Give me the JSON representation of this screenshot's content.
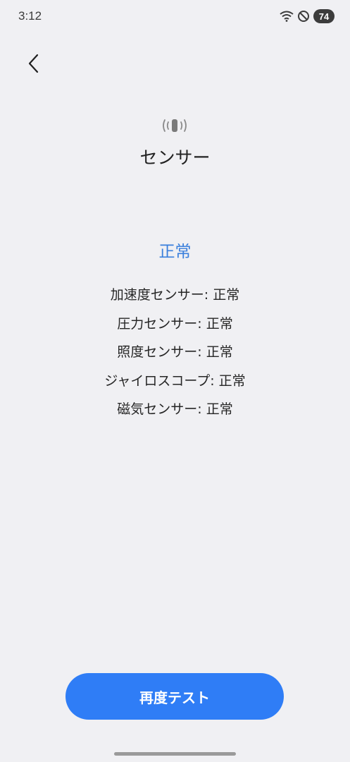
{
  "status_bar": {
    "time": "3:12",
    "battery": "74",
    "icons": [
      "wifi-icon",
      "do-not-disturb-icon",
      "battery-icon"
    ]
  },
  "header": {
    "back_icon": "chevron-left-icon"
  },
  "main": {
    "icon": "vibration-sensor-icon",
    "title": "センサー",
    "overall_status": "正常",
    "sensors": [
      {
        "label": "加速度センサー: 正常"
      },
      {
        "label": "圧力センサー: 正常"
      },
      {
        "label": "照度センサー: 正常"
      },
      {
        "label": "ジャイロスコープ: 正常"
      },
      {
        "label": "磁気センサー: 正常"
      }
    ]
  },
  "footer": {
    "retest_label": "再度テスト"
  },
  "colors": {
    "background": "#f0f0f3",
    "accent": "#2f7df6",
    "status_text": "#3a7fdc"
  }
}
